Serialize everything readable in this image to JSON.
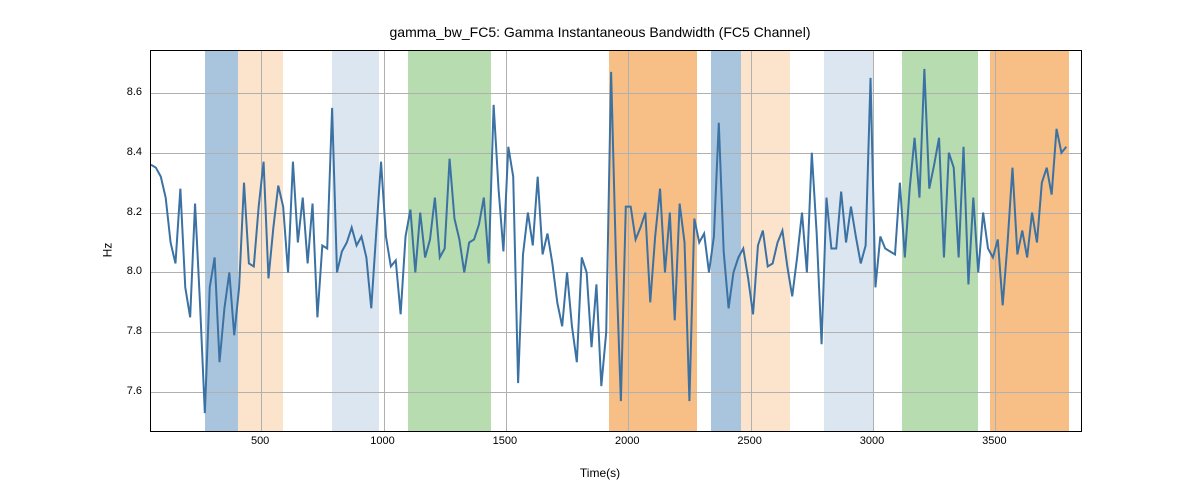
{
  "chart_data": {
    "type": "line",
    "title": "gamma_bw_FC5: Gamma Instantaneous Bandwidth (FC5 Channel)",
    "xlabel": "Time(s)",
    "ylabel": "Hz",
    "xlim": [
      50,
      3850
    ],
    "ylim": [
      7.47,
      8.74
    ],
    "xticks": [
      500,
      1000,
      1500,
      2000,
      2500,
      3000,
      3500
    ],
    "yticks": [
      7.6,
      7.8,
      8.0,
      8.2,
      8.4,
      8.6
    ],
    "bands": [
      {
        "x0": 270,
        "x1": 405,
        "color": "blue-dark"
      },
      {
        "x0": 405,
        "x1": 590,
        "color": "orange-light"
      },
      {
        "x0": 790,
        "x1": 980,
        "color": "blue-light"
      },
      {
        "x0": 1100,
        "x1": 1440,
        "color": "green"
      },
      {
        "x0": 1920,
        "x1": 2280,
        "color": "orange"
      },
      {
        "x0": 2340,
        "x1": 2460,
        "color": "blue-dark"
      },
      {
        "x0": 2460,
        "x1": 2660,
        "color": "orange-light"
      },
      {
        "x0": 2800,
        "x1": 3000,
        "color": "blue-light"
      },
      {
        "x0": 3120,
        "x1": 3430,
        "color": "green"
      },
      {
        "x0": 3480,
        "x1": 3800,
        "color": "orange"
      }
    ],
    "x": [
      50,
      70,
      90,
      110,
      130,
      150,
      170,
      190,
      210,
      230,
      250,
      270,
      290,
      310,
      330,
      350,
      370,
      390,
      410,
      430,
      450,
      470,
      490,
      510,
      530,
      550,
      570,
      590,
      610,
      630,
      650,
      670,
      690,
      710,
      730,
      750,
      770,
      790,
      810,
      830,
      850,
      870,
      890,
      910,
      930,
      950,
      970,
      990,
      1010,
      1030,
      1050,
      1070,
      1090,
      1110,
      1130,
      1150,
      1170,
      1190,
      1210,
      1230,
      1250,
      1270,
      1290,
      1310,
      1330,
      1350,
      1370,
      1390,
      1410,
      1430,
      1450,
      1470,
      1490,
      1510,
      1530,
      1550,
      1570,
      1590,
      1610,
      1630,
      1650,
      1670,
      1690,
      1710,
      1730,
      1750,
      1770,
      1790,
      1810,
      1830,
      1850,
      1870,
      1890,
      1910,
      1930,
      1950,
      1970,
      1990,
      2010,
      2030,
      2050,
      2070,
      2090,
      2110,
      2130,
      2150,
      2170,
      2190,
      2210,
      2230,
      2250,
      2270,
      2290,
      2310,
      2330,
      2350,
      2370,
      2390,
      2410,
      2430,
      2450,
      2470,
      2490,
      2510,
      2530,
      2550,
      2570,
      2590,
      2610,
      2630,
      2650,
      2670,
      2690,
      2710,
      2730,
      2750,
      2770,
      2790,
      2810,
      2830,
      2850,
      2870,
      2890,
      2910,
      2930,
      2950,
      2970,
      2990,
      3010,
      3030,
      3050,
      3070,
      3090,
      3110,
      3130,
      3150,
      3170,
      3190,
      3210,
      3230,
      3250,
      3270,
      3290,
      3310,
      3330,
      3350,
      3370,
      3390,
      3410,
      3430,
      3450,
      3470,
      3490,
      3510,
      3530,
      3550,
      3570,
      3590,
      3610,
      3630,
      3650,
      3670,
      3690,
      3710,
      3730,
      3750,
      3770,
      3790
    ],
    "values": [
      8.36,
      8.35,
      8.32,
      8.25,
      8.1,
      8.03,
      8.28,
      7.95,
      7.85,
      8.23,
      7.9,
      7.53,
      7.95,
      8.05,
      7.7,
      7.88,
      8.0,
      7.79,
      7.95,
      8.3,
      8.03,
      8.02,
      8.22,
      8.37,
      7.98,
      8.15,
      8.29,
      8.22,
      8.0,
      8.37,
      8.1,
      8.25,
      8.03,
      8.23,
      7.85,
      8.09,
      8.08,
      8.55,
      8.0,
      8.07,
      8.1,
      8.15,
      8.09,
      8.12,
      8.05,
      7.88,
      8.13,
      8.37,
      8.12,
      8.02,
      8.04,
      7.86,
      8.12,
      8.21,
      8.0,
      8.2,
      8.05,
      8.11,
      8.25,
      8.05,
      8.08,
      8.38,
      8.18,
      8.11,
      8.0,
      8.1,
      8.11,
      8.16,
      8.25,
      8.03,
      8.56,
      8.28,
      8.07,
      8.42,
      8.32,
      7.63,
      8.06,
      8.2,
      8.09,
      8.32,
      8.06,
      8.13,
      8.03,
      7.9,
      7.82,
      8.0,
      7.82,
      7.7,
      8.05,
      8.0,
      7.75,
      7.96,
      7.62,
      7.8,
      8.67,
      8.04,
      7.57,
      8.22,
      8.22,
      8.11,
      8.15,
      8.2,
      7.9,
      8.12,
      8.28,
      8.0,
      8.2,
      7.84,
      8.23,
      8.1,
      7.57,
      8.18,
      8.1,
      8.13,
      8.0,
      8.12,
      8.5,
      8.07,
      7.88,
      8.0,
      8.05,
      8.08,
      7.98,
      7.86,
      8.09,
      8.14,
      8.02,
      8.03,
      8.1,
      8.14,
      8.02,
      7.92,
      8.05,
      8.2,
      8.0,
      8.4,
      8.13,
      7.76,
      8.25,
      8.08,
      8.08,
      8.27,
      8.1,
      8.22,
      8.12,
      8.03,
      8.09,
      8.65,
      7.95,
      8.12,
      8.08,
      8.07,
      8.06,
      8.3,
      8.05,
      8.28,
      8.45,
      8.25,
      8.68,
      8.28,
      8.36,
      8.45,
      8.05,
      8.4,
      8.35,
      8.05,
      8.42,
      7.96,
      8.25,
      8.0,
      8.2,
      8.08,
      8.05,
      8.11,
      7.89,
      8.1,
      8.35,
      8.06,
      8.14,
      8.05,
      8.2,
      8.1,
      8.3,
      8.35,
      8.26,
      8.48,
      8.4,
      8.42
    ]
  }
}
